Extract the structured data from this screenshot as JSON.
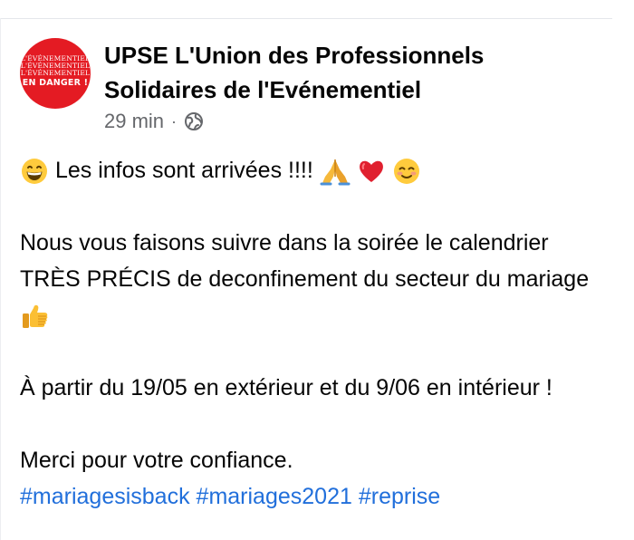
{
  "page": {
    "author": "UPSE L'Union des Professionnels Solidaires de l'Evénementiel",
    "avatar_lines": [
      "L'ÉVÉNEMENTIEL",
      "L'ÉVÉNEMENTIEL",
      "L'ÉVÉNEMENTIEL",
      "EN DANGER !"
    ],
    "timestamp": "29 min",
    "separator": "·",
    "privacy_icon": "globe-icon"
  },
  "post": {
    "line1": "Les infos sont arrivées !!!!",
    "line1_emojis": [
      "grinning-face",
      "folded-hands",
      "red-heart",
      "smiling-face"
    ],
    "paragraph2": "Nous vous faisons suivre dans la soirée le calendrier TRÈS PRÉCIS de deconfinement du secteur du mariage",
    "paragraph2_emoji": "thumbs-up",
    "paragraph3": "À partir du 19/05 en extérieur et du 9/06 en intérieur !",
    "paragraph4": "Merci pour votre confiance.",
    "hashtags": [
      "#mariagesisback",
      "#mariages2021",
      "#reprise"
    ],
    "hashtag_color": "#216fdb"
  }
}
